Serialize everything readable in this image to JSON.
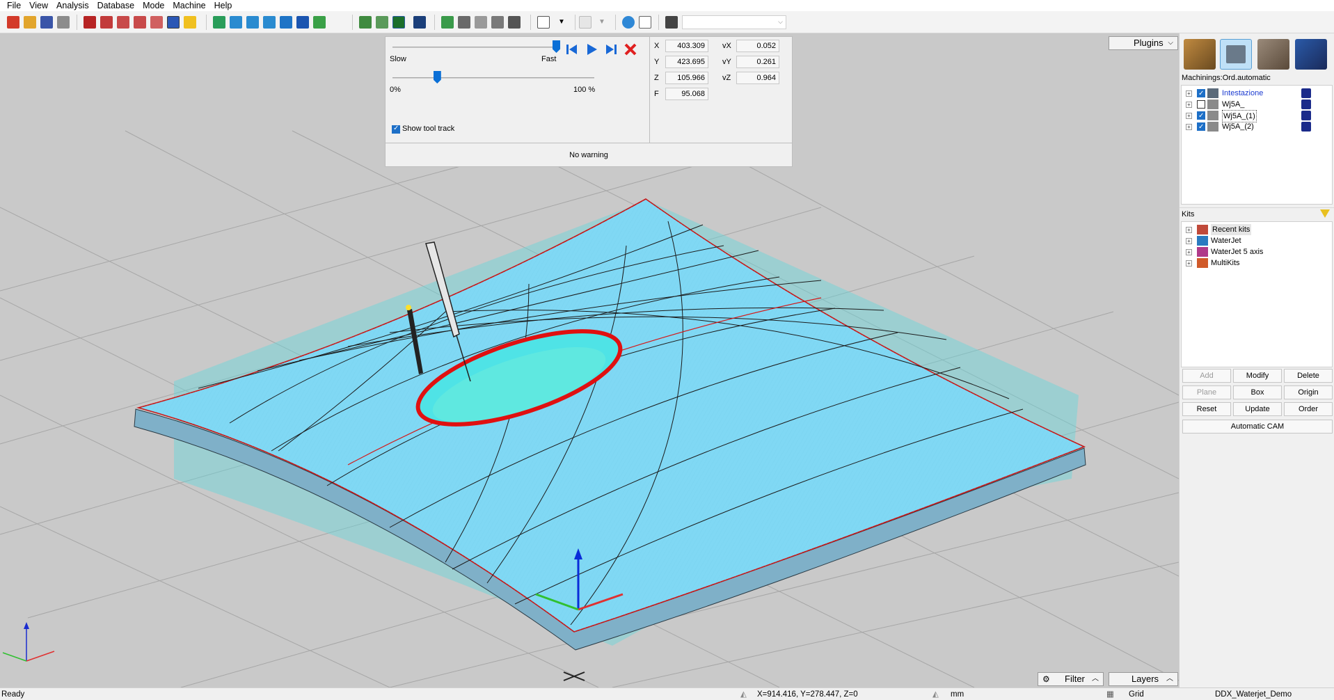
{
  "menu": [
    "File",
    "View",
    "Analysis",
    "Database",
    "Mode",
    "Machine",
    "Help"
  ],
  "simulation": {
    "speed_min_label": "Slow",
    "speed_max_label": "Fast",
    "speed_level": 1.0,
    "progress_min_label": "0%",
    "progress_max_label": "100 %",
    "progress_level": 0.22,
    "show_tool_track_label": "Show tool track",
    "show_tool_track_checked": true,
    "warning": "No warning",
    "coords": {
      "x_label": "X",
      "x": "403.309",
      "y_label": "Y",
      "y": "423.695",
      "z_label": "Z",
      "z": "105.966",
      "f_label": "F",
      "f": "95.068",
      "vx_label": "vX",
      "vx": "0.052",
      "vy_label": "vY",
      "vy": "0.261",
      "vz_label": "vZ",
      "vz": "0.964"
    }
  },
  "plugins_label": "Plugins",
  "machinings": {
    "title": "Machinings:Ord.automatic",
    "items": [
      {
        "label": "Intestazione",
        "checked": true,
        "highlight": true
      },
      {
        "label": "Wj5A_",
        "checked": false,
        "highlight": false
      },
      {
        "label": "Wj5A_(1)",
        "checked": true,
        "highlight": false
      },
      {
        "label": "Wj5A_(2)",
        "checked": true,
        "highlight": false
      }
    ]
  },
  "kits": {
    "title": "Kits",
    "items": [
      "Recent kits",
      "WaterJet",
      "WaterJet 5 axis",
      "MultiKits"
    ]
  },
  "buttons": {
    "add": "Add",
    "modify": "Modify",
    "delete": "Delete",
    "plane": "Plane",
    "box": "Box",
    "origin": "Origin",
    "reset": "Reset",
    "update": "Update",
    "order": "Order",
    "automatic_cam": "Automatic CAM"
  },
  "viewport_buttons": {
    "filter": "Filter",
    "layers": "Layers"
  },
  "status": {
    "ready": "Ready",
    "coords": "X=914.416, Y=278.447, Z=0",
    "unit": "mm",
    "grid": "Grid",
    "project": "DDX_Waterjet_Demo"
  },
  "colors": {
    "viewport_bg": "#c9c9c9",
    "surface": "#80d8f4",
    "contour_red": "#e01010",
    "accent_blue": "#0a6fd6"
  }
}
